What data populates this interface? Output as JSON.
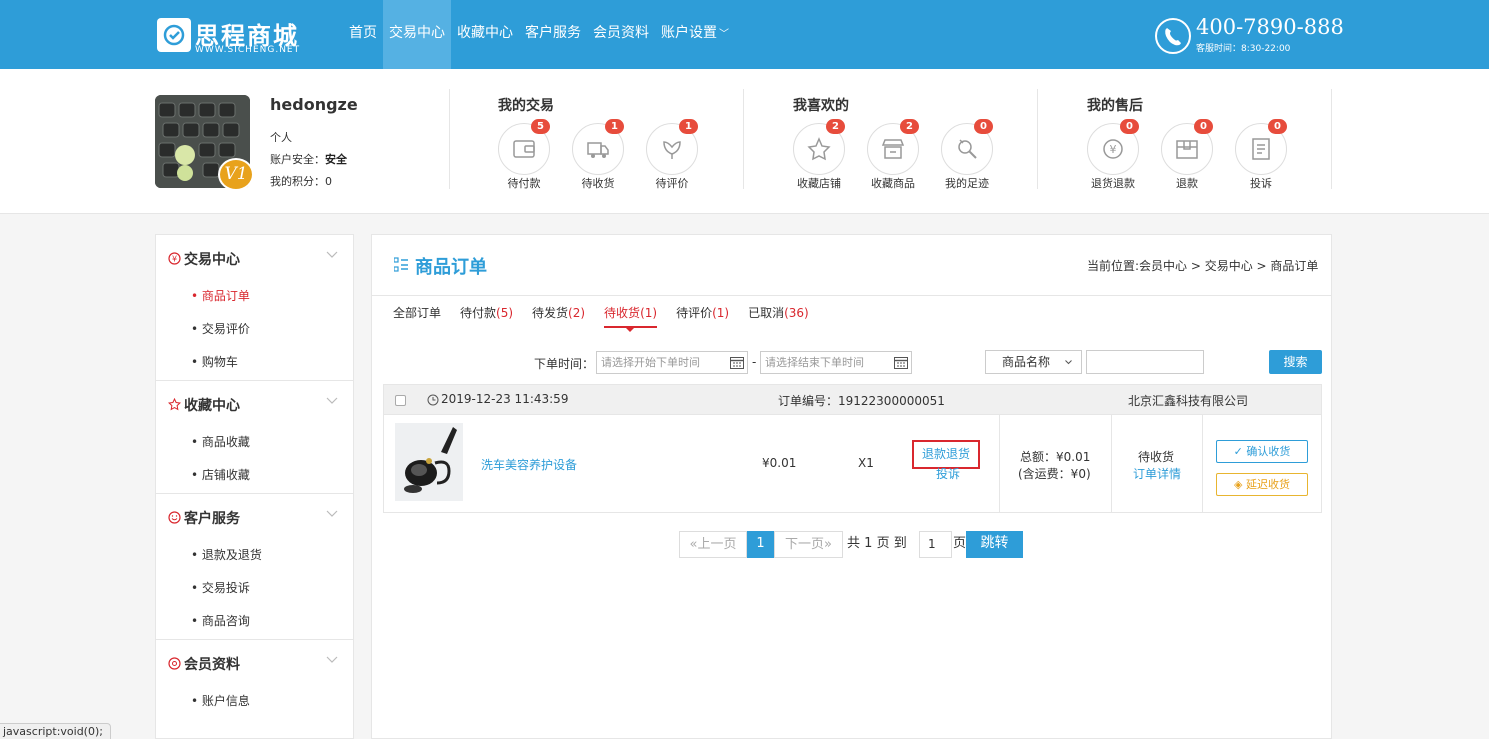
{
  "brand": {
    "name": "思程商城",
    "url": "WWW.SICHENG.NET"
  },
  "nav": [
    {
      "label": "首页",
      "active": false
    },
    {
      "label": "交易中心",
      "active": true
    },
    {
      "label": "收藏中心",
      "active": false
    },
    {
      "label": "客户服务",
      "active": false
    },
    {
      "label": "会员资料",
      "active": false
    },
    {
      "label": "账户设置",
      "active": false,
      "has_caret": true
    }
  ],
  "hotline": {
    "number": "400-7890-888",
    "hours": "客服时间：8:30-22:00"
  },
  "user": {
    "name": "hedongze",
    "type": "个人",
    "security_label": "账户安全：",
    "security_value": "安全",
    "points_label": "我的积分：",
    "points_value": "0",
    "level_badge": "V1"
  },
  "profile_groups": [
    {
      "title": "我的交易",
      "items": [
        {
          "label": "待付款",
          "count": "5",
          "icon": "wallet-icon"
        },
        {
          "label": "待收货",
          "count": "1",
          "icon": "truck-icon"
        },
        {
          "label": "待评价",
          "count": "1",
          "icon": "flower-icon"
        }
      ]
    },
    {
      "title": "我喜欢的",
      "items": [
        {
          "label": "收藏店铺",
          "count": "2",
          "icon": "star-icon"
        },
        {
          "label": "收藏商品",
          "count": "2",
          "icon": "shop-icon"
        },
        {
          "label": "我的足迹",
          "count": "0",
          "icon": "footprint-icon"
        }
      ]
    },
    {
      "title": "我的售后",
      "items": [
        {
          "label": "退货退款",
          "count": "0",
          "icon": "yen-refund-icon"
        },
        {
          "label": "退款",
          "count": "0",
          "icon": "box-icon"
        },
        {
          "label": "投诉",
          "count": "0",
          "icon": "document-icon"
        }
      ]
    }
  ],
  "sidebar": [
    {
      "title": "交易中心",
      "icon": "yen-circle-icon",
      "items": [
        {
          "label": "• 商品订单",
          "active": true
        },
        {
          "label": "• 交易评价",
          "active": false
        },
        {
          "label": "• 购物车",
          "active": false
        }
      ]
    },
    {
      "title": "收藏中心",
      "icon": "star-icon",
      "items": [
        {
          "label": "• 商品收藏",
          "active": false
        },
        {
          "label": "• 店铺收藏",
          "active": false
        }
      ]
    },
    {
      "title": "客户服务",
      "icon": "smile-icon",
      "items": [
        {
          "label": "• 退款及退货",
          "active": false
        },
        {
          "label": "• 交易投诉",
          "active": false
        },
        {
          "label": "• 商品咨询",
          "active": false
        }
      ]
    },
    {
      "title": "会员资料",
      "icon": "at-icon",
      "items": [
        {
          "label": "• 账户信息",
          "active": false
        }
      ]
    }
  ],
  "main": {
    "title": "商品订单",
    "breadcrumb": "当前位置:会员中心 > 交易中心 > 商品订单",
    "tabs": [
      {
        "label": "全部订单",
        "count": "",
        "active": false
      },
      {
        "label": "待付款",
        "count": "(5)",
        "active": false
      },
      {
        "label": "待发货",
        "count": "(2)",
        "active": false
      },
      {
        "label": "待收货",
        "count": "(1)",
        "active": true
      },
      {
        "label": "待评价",
        "count": "(1)",
        "active": false
      },
      {
        "label": "已取消",
        "count": "(36)",
        "active": false
      }
    ],
    "filter": {
      "label": "下单时间：",
      "start_placeholder": "请选择开始下单时间",
      "dash": "-",
      "end_placeholder": "请选择结束下单时间",
      "select_value": "商品名称",
      "search_value": "",
      "search_button": "搜索"
    }
  },
  "order": {
    "datetime": "2019-12-23 11:43:59",
    "number": "订单编号：19122300000051",
    "shop": "北京汇鑫科技有限公司",
    "product_name": "洗车美容养护设备",
    "price": "¥0.01",
    "qty": "X1",
    "refund_link": "退款退货",
    "complain_link": "投诉",
    "total": "总额：¥0.01",
    "shipping": "(含运费：¥0)",
    "status": "待收货",
    "detail_link": "订单详情",
    "confirm_button": "✓ 确认收货",
    "delay_button": "延迟收货"
  },
  "pagination": {
    "prev": "«上一页",
    "current": "1",
    "next": "下一页»",
    "total_prefix": "共",
    "total_pages": "1",
    "total_suffix": "页",
    "goto_label": "到",
    "goto_value": "1",
    "goto_suffix": "页",
    "go_button": "跳转"
  },
  "statusbar": "javascript:void(0);",
  "colors": {
    "primary": "#2e9dd8",
    "accent_red": "#d9272e",
    "badge_red": "#e74c3c",
    "warning": "#e8a21c"
  }
}
